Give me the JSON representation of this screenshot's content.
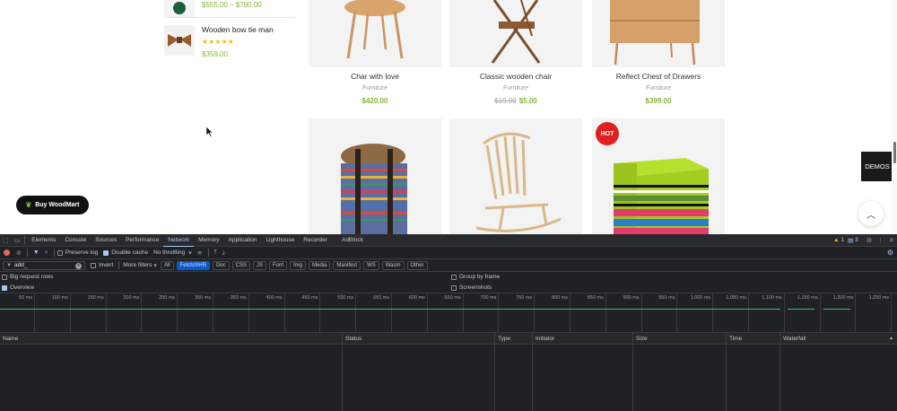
{
  "sidebar_products": [
    {
      "name": "",
      "price": "$555.00 – $780.00"
    },
    {
      "name": "Wooden bow tie man",
      "stars": "★★★★★",
      "price": "$359.00"
    }
  ],
  "products_row1": [
    {
      "name": "Char with love",
      "category": "Furniture",
      "price": "$420.00"
    },
    {
      "name": "Classic wooden chair",
      "category": "Furniture",
      "old_price": "$19.00",
      "price": "$5.00"
    },
    {
      "name": "Reflect Chest of Drawers",
      "category": "Furniture",
      "price": "$399.00"
    }
  ],
  "hot_badge": "HOT",
  "buy_button": "Buy WoodMart",
  "demos_button": "DEMOS",
  "devtools": {
    "tabs": [
      "Elements",
      "Console",
      "Sources",
      "Performance",
      "Network",
      "Memory",
      "Application",
      "Lighthouse",
      "Recorder",
      "AdBlock"
    ],
    "active_tab": "Network",
    "warnings": "1",
    "messages": "3",
    "preserve_log": "Preserve log",
    "disable_cache": "Disable cache",
    "throttling": "No throttling",
    "filter_value": "add_",
    "invert": "Invert",
    "more_filters": "More filters",
    "filter_types": [
      "All",
      "Fetch/XHR",
      "Doc",
      "CSS",
      "JS",
      "Font",
      "Img",
      "Media",
      "Manifest",
      "WS",
      "Wasm",
      "Other"
    ],
    "active_filter": "Fetch/XHR",
    "big_request_rows": "Big request rows",
    "overview": "Overview",
    "group_by_frame": "Group by frame",
    "screenshots": "Screenshots",
    "ticks": [
      "50 ms",
      "100 ms",
      "150 ms",
      "200 ms",
      "250 ms",
      "300 ms",
      "350 ms",
      "400 ms",
      "450 ms",
      "500 ms",
      "550 ms",
      "600 ms",
      "650 ms",
      "700 ms",
      "750 ms",
      "800 ms",
      "850 ms",
      "900 ms",
      "950 ms",
      "1,000 ms",
      "1,050 ms",
      "1,100 ms",
      "1,150 ms",
      "1,200 ms",
      "1,250 ms"
    ],
    "columns": [
      "Name",
      "Status",
      "Type",
      "Initiator",
      "Size",
      "Time",
      "Waterfall"
    ]
  },
  "colors": {
    "accent_green": "#83b735",
    "hot_red": "#e02020",
    "devtools_bg": "#202124",
    "devtools_active": "#a8c7fa"
  }
}
